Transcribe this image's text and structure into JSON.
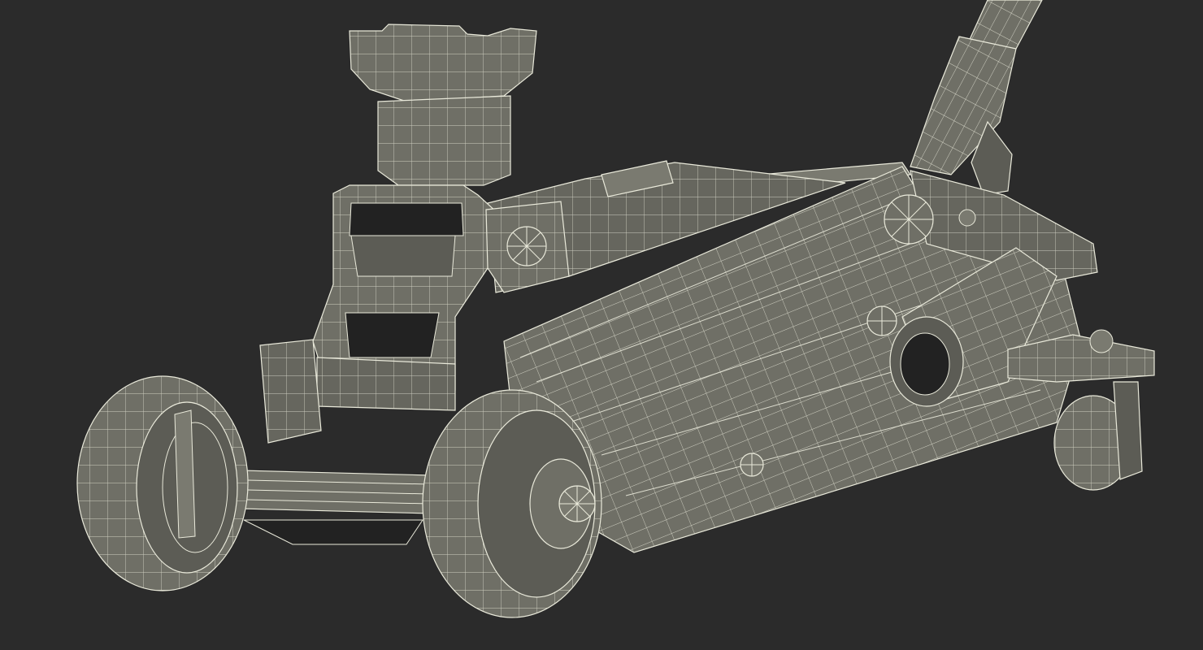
{
  "scene": {
    "subject": "floor-jack-wireframe-render",
    "colors": {
      "background": "#2b2b2b",
      "body_fill": "#6f6f66",
      "body_shade": "#5c5c55",
      "body_dark": "#47473f",
      "wire": "#e9e9da",
      "cavity": "#222222"
    }
  }
}
